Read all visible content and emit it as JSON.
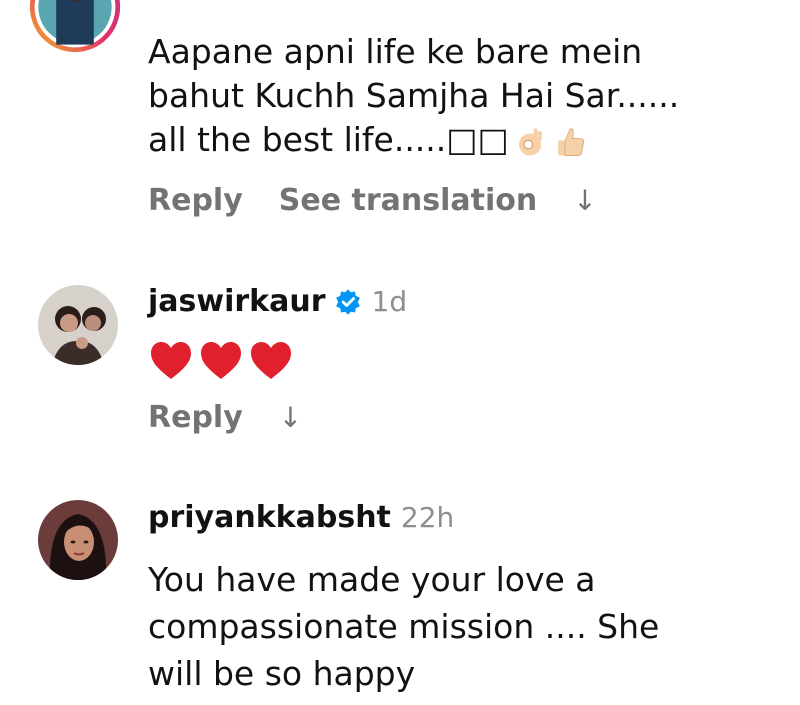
{
  "comments": [
    {
      "username": "",
      "text": "Aapane apni life ke bare mein\nbahut Kuchh Samjha Hai Sar......\nall the best life.....□□",
      "emojis": [
        "ok-hand-icon",
        "thumbs-up-icon"
      ],
      "reply_label": "Reply",
      "translate_label": "See translation",
      "arrow": "↓"
    },
    {
      "username": "jaswirkaur",
      "verified": true,
      "time": "1d",
      "emojis": [
        "heart-icon",
        "heart-icon",
        "heart-icon"
      ],
      "reply_label": "Reply",
      "arrow": "↓"
    },
    {
      "username": "priyankkabsht",
      "time": "22h",
      "text": "You have made your love a\ncompassionate mission .... She\nwill be so happy"
    }
  ],
  "colors": {
    "heart": "#e0202d",
    "verified": "#0095f6",
    "muted": "#737373",
    "story_ring": "#f5b324"
  }
}
